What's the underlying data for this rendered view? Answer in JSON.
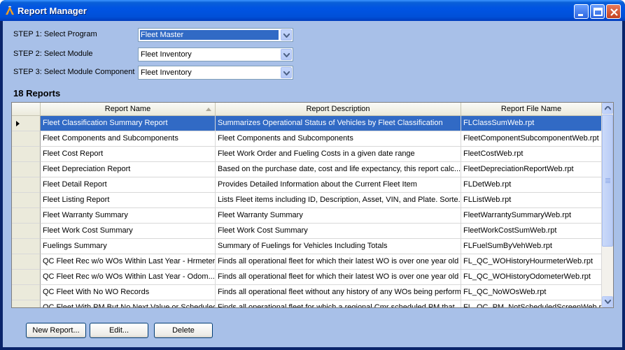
{
  "window": {
    "title": "Report Manager"
  },
  "steps": [
    {
      "label": "STEP 1: Select Program",
      "value": "Fleet Master"
    },
    {
      "label": "STEP 2: Select Module",
      "value": "Fleet Inventory"
    },
    {
      "label": "STEP 3: Select Module Component",
      "value": "Fleet Inventory"
    }
  ],
  "reports": {
    "count_label": "18 Reports",
    "columns": [
      "Report Name",
      "Report Description",
      "Report File Name"
    ],
    "rows": [
      {
        "name": "Fleet Classification Summary Report",
        "desc": "Summarizes Operational Status of Vehicles by Fleet Classification",
        "file": "FLClassSumWeb.rpt"
      },
      {
        "name": "Fleet Components and Subcomponents",
        "desc": "Fleet Components and Subcomponents",
        "file": "FleetComponentSubcomponentWeb.rpt"
      },
      {
        "name": "Fleet Cost Report",
        "desc": "Fleet Work Order and Fueling Costs in a given date range",
        "file": "FleetCostWeb.rpt"
      },
      {
        "name": "Fleet Depreciation Report",
        "desc": "Based on the purchase date, cost and life expectancy, this report calc...",
        "file": "FleetDepreciationReportWeb.rpt"
      },
      {
        "name": "Fleet Detail Report",
        "desc": "Provides Detailed Information about the Current Fleet Item",
        "file": "FLDetWeb.rpt"
      },
      {
        "name": "Fleet Listing Report",
        "desc": "Lists Fleet items including ID, Description, Asset, VIN, and Plate.  Sorte...",
        "file": "FLListWeb.rpt"
      },
      {
        "name": "Fleet Warranty Summary",
        "desc": "Fleet Warranty Summary",
        "file": "FleetWarrantySummaryWeb.rpt"
      },
      {
        "name": "Fleet Work Cost Summary",
        "desc": "Fleet Work Cost Summary",
        "file": "FleetWorkCostSumWeb.rpt"
      },
      {
        "name": "Fuelings Summary",
        "desc": "Summary of Fuelings for Vehicles Including Totals",
        "file": "FLFuelSumByVehWeb.rpt"
      },
      {
        "name": "QC Fleet Rec w/o WOs Within Last Year - Hrmeter",
        "desc": "Finds all operational fleet for which their latest WO is over one year old ...",
        "file": "FL_QC_WOHistoryHourmeterWeb.rpt"
      },
      {
        "name": "QC Fleet Rec w/o WOs Within Last Year - Odom...",
        "desc": "Finds all operational fleet for which their latest WO is over one year old ...",
        "file": "FL_QC_WOHistoryOdometerWeb.rpt"
      },
      {
        "name": "QC Fleet With No WO Records",
        "desc": "Finds all operational fleet without any history of any WOs being perform...",
        "file": "FL_QC_NoWOsWeb.rpt"
      },
      {
        "name": "QC Fleet With PM But No Next Value or Scheduled...",
        "desc": "Finds all operational fleet for which a regional Cmr scheduled PM that...",
        "file": "FL_QC_PM_NotScheduledScreenWeb.rpt"
      }
    ]
  },
  "buttons": {
    "new_report": "New Report...",
    "edit": "Edit...",
    "delete": "Delete"
  },
  "colors": {
    "selection": "#316ac5",
    "client_bg": "#a8c0e8",
    "title_blue": "#0054e3"
  }
}
